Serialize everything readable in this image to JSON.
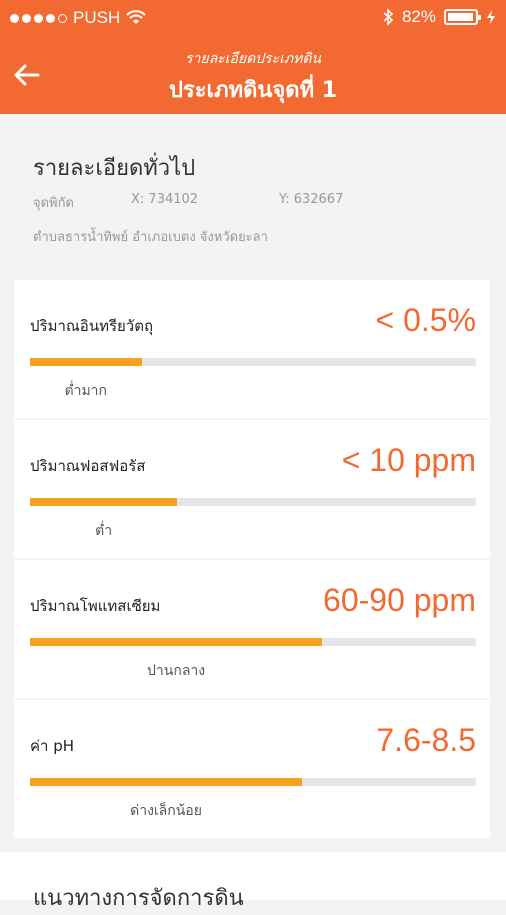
{
  "status_bar": {
    "carrier": "PUSH",
    "signal_filled": 4,
    "signal_total": 5,
    "battery_text": "82%",
    "battery_level": 0.82
  },
  "nav": {
    "subtitle": "รายละเอียดประเภทดิน",
    "title": "ประเภทดินจุดที่ 1"
  },
  "general": {
    "title": "รายละเอียดทั่วไป",
    "coord_label": "จุดพิกัด",
    "x": "X: 734102",
    "y": "Y: 632667",
    "address": "ตำบลธารน้ำทิพย์ อำเภอเบตง จังหวัดยะลา"
  },
  "metrics": [
    {
      "label": "ปริมาณอินทรียวัตถุ",
      "value": "< 0.5%",
      "level": "ต่ำมาก",
      "fill": 0.25
    },
    {
      "label": "ปริมาณฟอสฟอรัส",
      "value": "< 10 ppm",
      "level": "ต่ำ",
      "fill": 0.33
    },
    {
      "label": "ปริมาณโพแทสเซียม",
      "value": "60-90 ppm",
      "level": "ปานกลาง",
      "fill": 0.655
    },
    {
      "label": "ค่า pH",
      "value": "7.6-8.5",
      "level": "ด่างเล็กน้อย",
      "fill": 0.61
    }
  ],
  "guide": {
    "title": "แนวทางการจัดการดิน"
  },
  "colors": {
    "accent": "#f26a31",
    "bar_fill": "#f7a11e",
    "bar_track": "#e6e6e6"
  }
}
